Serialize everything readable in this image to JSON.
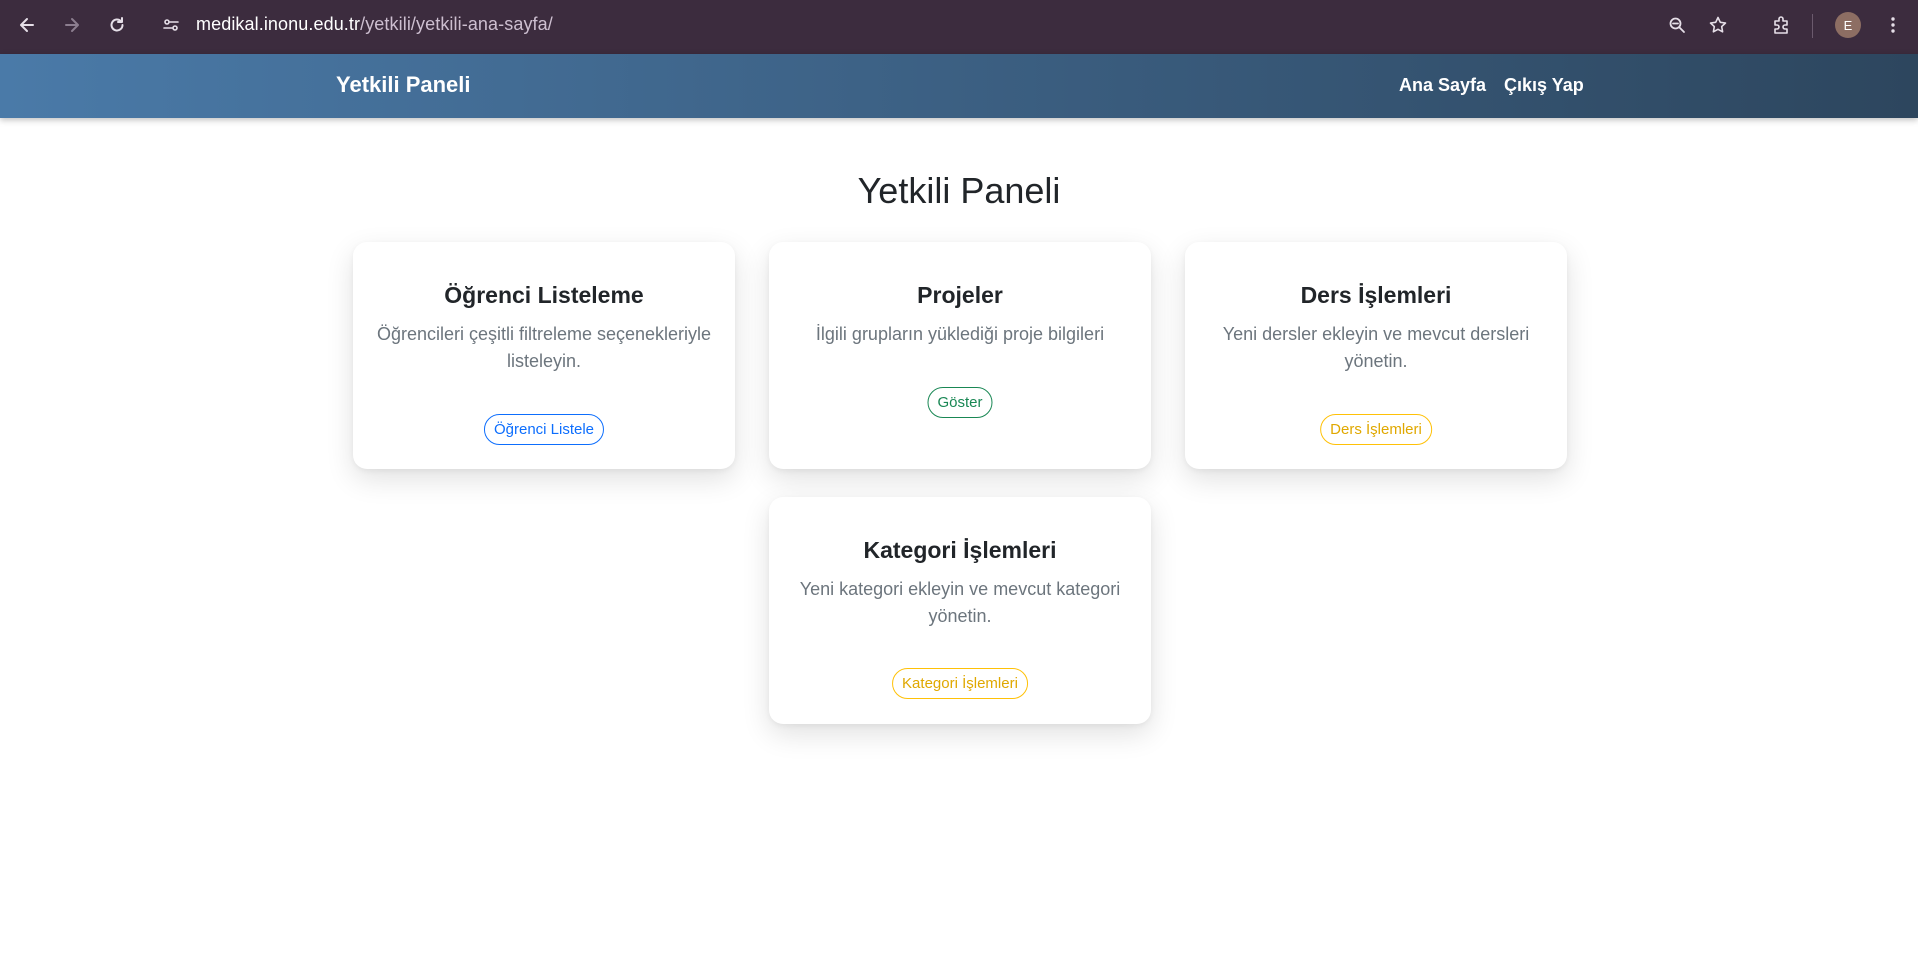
{
  "browser": {
    "url_host": "medikal.inonu.edu.tr",
    "url_path": "/yetkili/yetkili-ana-sayfa/",
    "profile_initial": "E",
    "icons": [
      "back-icon",
      "forward-icon",
      "reload-icon",
      "site-info-icon",
      "zoom-icon",
      "bookmark-star-icon",
      "extensions-icon",
      "menu-icon"
    ]
  },
  "navbar": {
    "brand": "Yetkili Paneli",
    "links": [
      {
        "label": "Ana Sayfa"
      },
      {
        "label": "Çıkış Yap"
      }
    ]
  },
  "main": {
    "title": "Yetkili Paneli",
    "cards": [
      {
        "title": "Öğrenci Listeleme",
        "description": "Öğrencileri çeşitli filtreleme seçenekleriyle listeleyin.",
        "button": "Öğrenci Listele",
        "button_color": "#0d6efd"
      },
      {
        "title": "Projeler",
        "description": "İlgili grupların yüklediği proje bilgileri",
        "button": "Göster",
        "button_color": "#198754"
      },
      {
        "title": "Ders İşlemleri",
        "description": "Yeni dersler ekleyin ve mevcut dersleri yönetin.",
        "button": "Ders İşlemleri",
        "button_color": "#ffc107"
      },
      {
        "title": "Kategori İşlemleri",
        "description": "Yeni kategori ekleyin ve mevcut kategori yönetin.",
        "button": "Kategori İşlemleri",
        "button_color": "#ffc107"
      }
    ]
  }
}
